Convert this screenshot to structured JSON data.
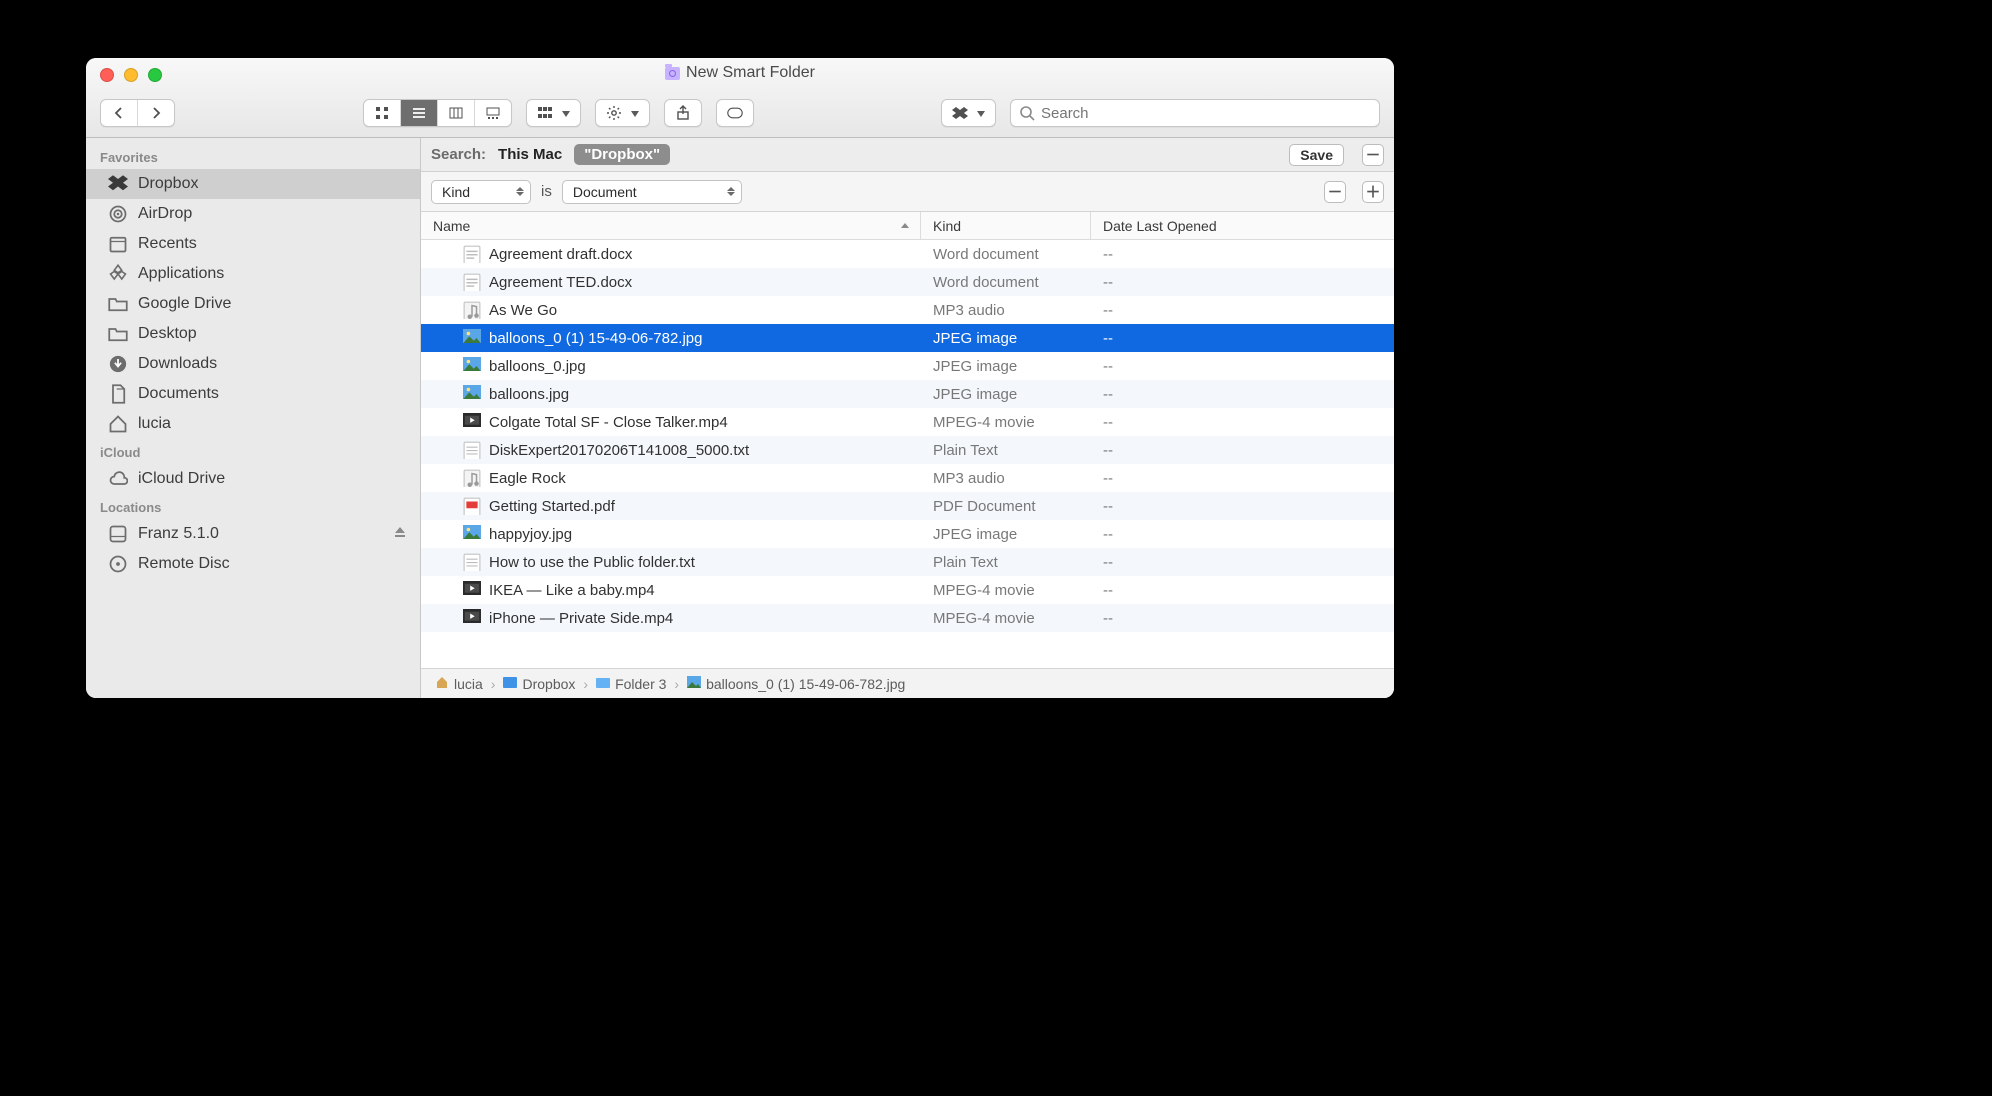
{
  "window": {
    "title": "New Smart Folder"
  },
  "search": {
    "placeholder": "Search"
  },
  "sidebar": {
    "sections": [
      {
        "label": "Favorites",
        "items": [
          {
            "label": "Dropbox",
            "icon": "dropbox",
            "selected": true
          },
          {
            "label": "AirDrop",
            "icon": "airdrop"
          },
          {
            "label": "Recents",
            "icon": "recents"
          },
          {
            "label": "Applications",
            "icon": "apps"
          },
          {
            "label": "Google Drive",
            "icon": "folder"
          },
          {
            "label": "Desktop",
            "icon": "folder"
          },
          {
            "label": "Downloads",
            "icon": "downloads"
          },
          {
            "label": "Documents",
            "icon": "documents"
          },
          {
            "label": "lucia",
            "icon": "home"
          }
        ]
      },
      {
        "label": "iCloud",
        "items": [
          {
            "label": "iCloud Drive",
            "icon": "cloud"
          }
        ]
      },
      {
        "label": "Locations",
        "items": [
          {
            "label": "Franz 5.1.0",
            "icon": "disk",
            "eject": true
          },
          {
            "label": "Remote Disc",
            "icon": "disc"
          }
        ]
      }
    ]
  },
  "scope": {
    "label": "Search:",
    "thismac": "This Mac",
    "pill": "\"Dropbox\"",
    "save": "Save"
  },
  "rule": {
    "attr": "Kind",
    "op": "is",
    "value": "Document"
  },
  "columns": {
    "name": "Name",
    "kind": "Kind",
    "date": "Date Last Opened"
  },
  "files": [
    {
      "name": "Agreement draft.docx",
      "kind": "Word document",
      "date": "--",
      "icon": "doc"
    },
    {
      "name": "Agreement TED.docx",
      "kind": "Word document",
      "date": "--",
      "icon": "doc"
    },
    {
      "name": "As We Go",
      "kind": "MP3 audio",
      "date": "--",
      "icon": "mp3"
    },
    {
      "name": "balloons_0 (1) 15-49-06-782.jpg",
      "kind": "JPEG image",
      "date": "--",
      "icon": "img",
      "selected": true
    },
    {
      "name": "balloons_0.jpg",
      "kind": "JPEG image",
      "date": "--",
      "icon": "img"
    },
    {
      "name": "balloons.jpg",
      "kind": "JPEG image",
      "date": "--",
      "icon": "img"
    },
    {
      "name": "Colgate Total SF - Close Talker.mp4",
      "kind": "MPEG-4 movie",
      "date": "--",
      "icon": "vid"
    },
    {
      "name": "DiskExpert20170206T141008_5000.txt",
      "kind": "Plain Text",
      "date": "--",
      "icon": "txt"
    },
    {
      "name": "Eagle Rock",
      "kind": "MP3 audio",
      "date": "--",
      "icon": "mp3"
    },
    {
      "name": "Getting Started.pdf",
      "kind": "PDF Document",
      "date": "--",
      "icon": "pdf"
    },
    {
      "name": "happyjoy.jpg",
      "kind": "JPEG image",
      "date": "--",
      "icon": "img"
    },
    {
      "name": "How to use the Public folder.txt",
      "kind": "Plain Text",
      "date": "--",
      "icon": "txt"
    },
    {
      "name": "IKEA — Like a baby.mp4",
      "kind": "MPEG-4 movie",
      "date": "--",
      "icon": "vid"
    },
    {
      "name": "iPhone — Private Side.mp4",
      "kind": "MPEG-4 movie",
      "date": "--",
      "icon": "vid"
    }
  ],
  "pathbar": [
    {
      "label": "lucia",
      "icon": "home"
    },
    {
      "label": "Dropbox",
      "icon": "dbx"
    },
    {
      "label": "Folder 3",
      "icon": "folder"
    },
    {
      "label": "balloons_0 (1) 15-49-06-782.jpg",
      "icon": "img"
    }
  ]
}
